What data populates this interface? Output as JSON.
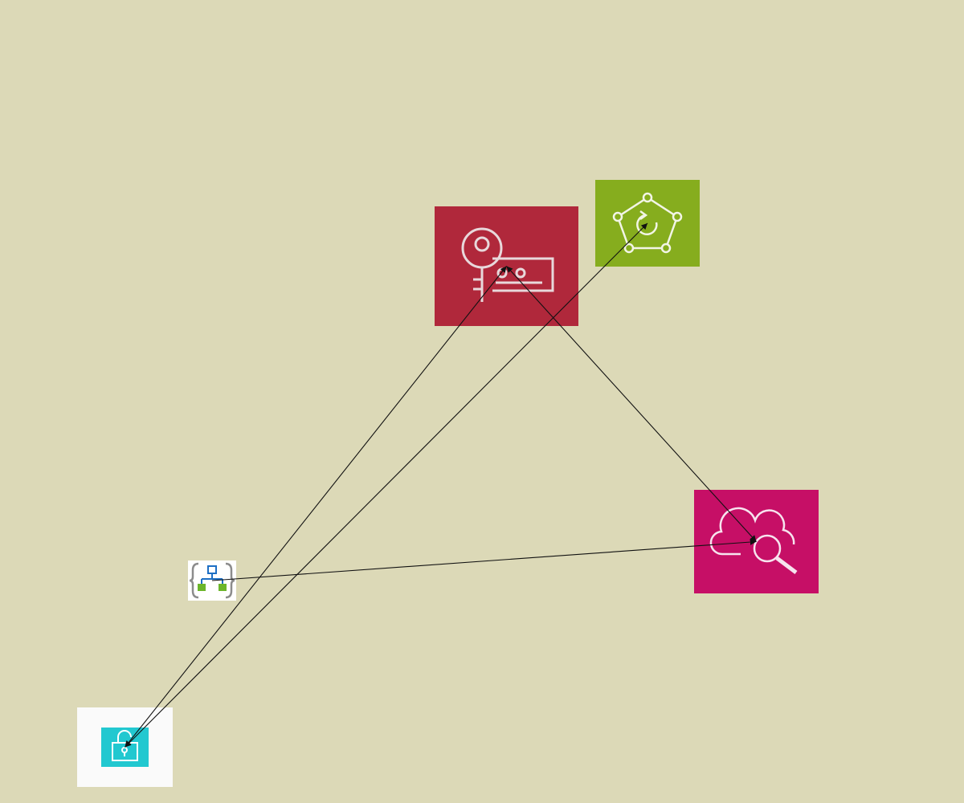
{
  "diagram": {
    "background": "#dcd9b7",
    "edge_color": "#111111",
    "nodes": [
      {
        "id": "key-card",
        "icon": "key-card-icon",
        "color": "#b0283b"
      },
      {
        "id": "pentagon-refresh",
        "icon": "pentagon-refresh-network-icon",
        "color": "#86ad1e"
      },
      {
        "id": "cloud-search",
        "icon": "cloud-search-icon",
        "color": "#c60f66"
      },
      {
        "id": "template",
        "icon": "braces-hierarchy-icon",
        "color": "#ffffff"
      },
      {
        "id": "padlock",
        "icon": "padlock-icon",
        "color": "#22c8d0"
      }
    ],
    "edges": [
      {
        "from": "padlock",
        "to": "key-card",
        "arrows": "both"
      },
      {
        "from": "padlock",
        "to": "pentagon-refresh",
        "arrows": "both"
      },
      {
        "from": "key-card",
        "to": "cloud-search",
        "arrows": "both"
      },
      {
        "from": "template",
        "to": "cloud-search",
        "arrows": "end"
      }
    ]
  }
}
